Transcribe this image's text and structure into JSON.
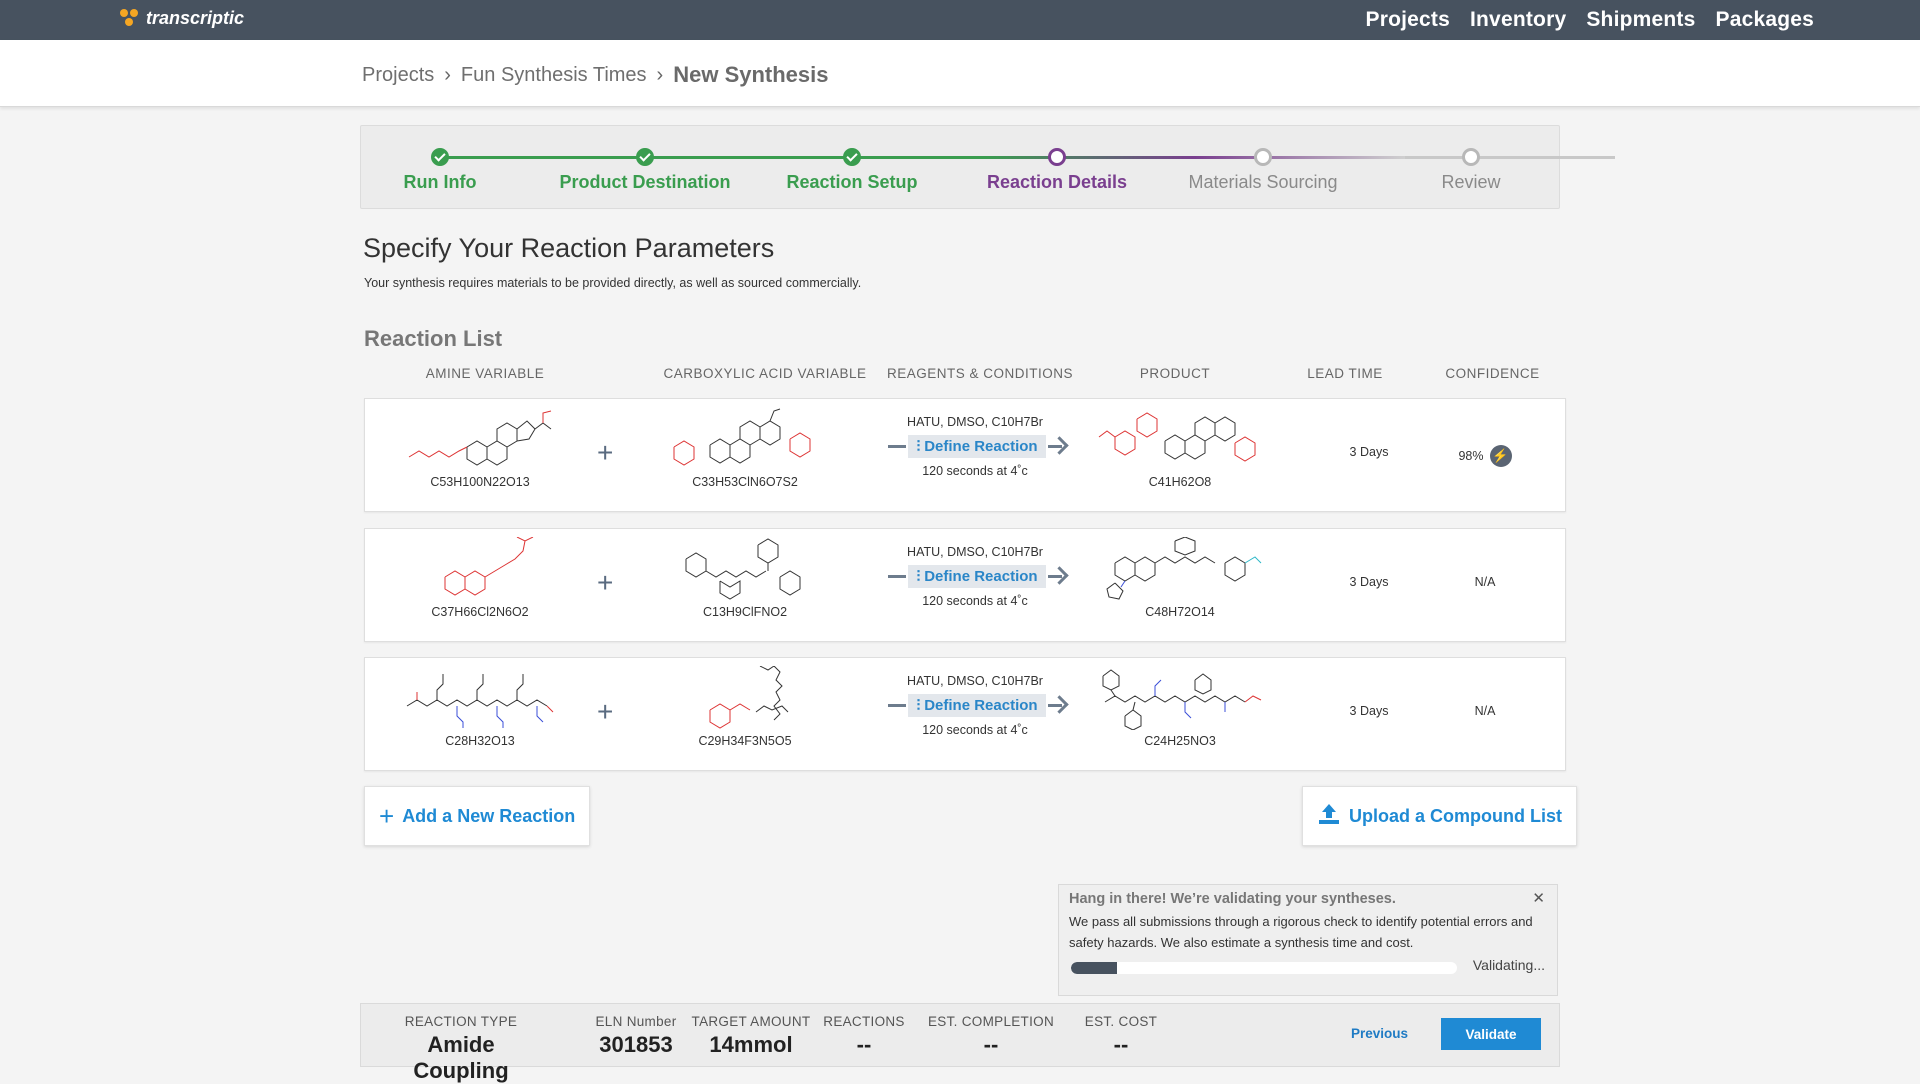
{
  "app": {
    "logo_text": "transcriptic"
  },
  "nav": [
    "Projects",
    "Inventory",
    "Shipments",
    "Packages"
  ],
  "breadcrumb": {
    "items": [
      "Projects",
      "Fun Synthesis Times"
    ],
    "current": "New Synthesis"
  },
  "steps": [
    {
      "label": "Run Info",
      "state": "done"
    },
    {
      "label": "Product Destination",
      "state": "done"
    },
    {
      "label": "Reaction Setup",
      "state": "done"
    },
    {
      "label": "Reaction Details",
      "state": "active"
    },
    {
      "label": "Materials Sourcing",
      "state": "todo"
    },
    {
      "label": "Review",
      "state": "todo"
    }
  ],
  "page": {
    "title": "Specify Your Reaction Parameters",
    "subtitle": "Your synthesis requires materials to be provided directly, as well as sourced commercially.",
    "list_title": "Reaction List"
  },
  "columns": [
    "AMINE VARIABLE",
    "CARBOXYLIC ACID VARIABLE",
    "REAGENTS & CONDITIONS",
    "PRODUCT",
    "LEAD TIME",
    "CONFIDENCE"
  ],
  "reactions": [
    {
      "amine": "C53H100N22O13",
      "acid": "C33H53ClN6O7S2",
      "reagents": "HATU, DMSO, C10H7Br",
      "button": "Define Reaction",
      "conditions": "120 seconds at 4˚c",
      "product": "C41H62O8",
      "lead_time": "3 Days",
      "confidence": "98%"
    },
    {
      "amine": "C37H66Cl2N6O2",
      "acid": "C13H9ClFNO2",
      "reagents": "HATU, DMSO, C10H7Br",
      "button": "Define Reaction",
      "conditions": "120 seconds at 4˚c",
      "product": "C48H72O14",
      "lead_time": "3 Days",
      "confidence": "N/A"
    },
    {
      "amine": "C28H32O13",
      "acid": "C29H34F3N5O5",
      "reagents": "HATU, DMSO, C10H7Br",
      "button": "Define Reaction",
      "conditions": "120 seconds at 4˚c",
      "product": "C24H25NO3",
      "lead_time": "3 Days",
      "confidence": "N/A"
    }
  ],
  "actions": {
    "add": "Add a New Reaction",
    "upload": "Upload a Compound List"
  },
  "toast": {
    "title": "Hang in there! We’re validating your syntheses.",
    "body": "We pass all submissions through a rigorous check to identify potential errors and safety hazards. We also estimate a synthesis time and cost.",
    "status": "Validating...",
    "progress": 0.12
  },
  "footer": {
    "stats": [
      {
        "label": "REACTION TYPE",
        "value": "Amide Coupling"
      },
      {
        "label": "ELN Number",
        "value": "301853"
      },
      {
        "label": "TARGET AMOUNT",
        "value": "14mmol"
      },
      {
        "label": "REACTIONS",
        "value": "--"
      },
      {
        "label": "EST. COMPLETION",
        "value": "--"
      },
      {
        "label": "EST. COST",
        "value": "--"
      }
    ],
    "previous": "Previous",
    "validate": "Validate"
  },
  "colors": {
    "topbar": "#47525f",
    "done": "#3a9d4f",
    "active": "#7a3f8f",
    "link": "#1f8ad4"
  }
}
